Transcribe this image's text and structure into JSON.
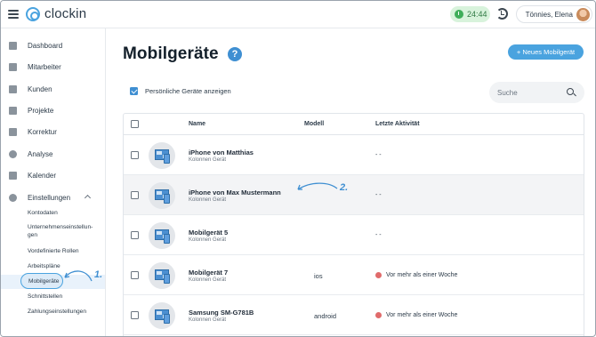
{
  "app": {
    "logo_text": "clockin"
  },
  "header": {
    "timer": "24:44",
    "user_name": "Tönnies, Elena"
  },
  "sidebar": {
    "items": [
      {
        "label": "Dashboard"
      },
      {
        "label": "Mitarbeiter"
      },
      {
        "label": "Kunden"
      },
      {
        "label": "Projekte"
      },
      {
        "label": "Korrektur"
      },
      {
        "label": "Analyse"
      },
      {
        "label": "Kalender"
      },
      {
        "label": "Einstellungen"
      }
    ],
    "sub_items": [
      {
        "label": "Kontodaten"
      },
      {
        "label": "Unternehmenseinstellun-"
      },
      {
        "label": "gen"
      },
      {
        "label": "Vordefinierte Rollen"
      },
      {
        "label": "Arbeitspläne"
      },
      {
        "label": "Mobilgeräte"
      },
      {
        "label": "Schnittstellen"
      },
      {
        "label": "Zahlungseinstellungen"
      }
    ]
  },
  "main": {
    "title": "Mobilgeräte",
    "help": "?",
    "new_button": "+ Neues Mobilgerät",
    "personal_label": "Persönliche Geräte anzeigen",
    "search_placeholder": "Suche",
    "columns": [
      "Name",
      "Modell",
      "Letzte Aktivität"
    ],
    "rows": [
      {
        "name": "iPhone von Matthias",
        "type": "Kolonnen Gerät",
        "model": "",
        "activity": "- -"
      },
      {
        "name": "iPhone von Max Mustermann",
        "type": "Kolonnen Gerät",
        "model": "",
        "activity": "- -"
      },
      {
        "name": "Mobilgerät 5",
        "type": "Kolonnen Gerät",
        "model": "",
        "activity": "- -"
      },
      {
        "name": "Mobilgerät 7",
        "type": "Kolonnen Gerät",
        "model": "ios",
        "activity": "Vor mehr als einer Woche"
      },
      {
        "name": "Samsung SM-G781B",
        "type": "Kolonnen Gerät",
        "model": "android",
        "activity": "Vor mehr als einer Woche"
      }
    ]
  },
  "annotations": {
    "step1": "1.",
    "step2": "2."
  },
  "colors": {
    "accent": "#4aa3df",
    "timer_bg": "#d8f3dc",
    "status_red": "#e06b6b"
  }
}
